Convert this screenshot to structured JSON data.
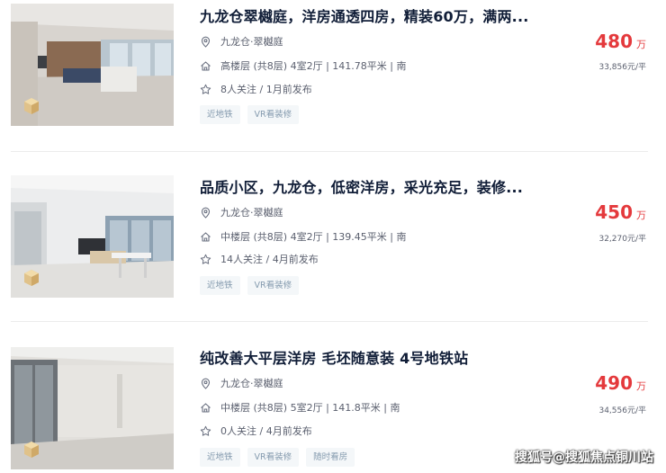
{
  "listings": [
    {
      "title": "九龙仓翠樾庭，洋房通透四房，精装60万，满两...",
      "community": "九龙仓·翠樾庭",
      "house_info": "高楼层 (共8层) 4室2厅 | 141.78平米 | 南",
      "follow_info": "8人关注 / 1月前发布",
      "price": "480",
      "price_unit": "万",
      "unit_price": "33,856元/平",
      "tags": [
        "近地铁",
        "VR看装修"
      ]
    },
    {
      "title": "品质小区，九龙仓，低密洋房，采光充足，装修...",
      "community": "九龙仓·翠樾庭",
      "house_info": "中楼层 (共8层) 4室2厅 | 139.45平米 | 南",
      "follow_info": "14人关注 / 4月前发布",
      "price": "450",
      "price_unit": "万",
      "unit_price": "32,270元/平",
      "tags": [
        "近地铁",
        "VR看装修"
      ]
    },
    {
      "title": "纯改善大平层洋房 毛坯随意装 4号地铁站",
      "community": "九龙仓·翠樾庭",
      "house_info": "中楼层 (共8层) 5室2厅 | 141.8平米 | 南",
      "follow_info": "0人关注 / 4月前发布",
      "price": "490",
      "price_unit": "万",
      "unit_price": "34,556元/平",
      "tags": [
        "近地铁",
        "VR看装修",
        "随时看房"
      ]
    }
  ],
  "icons": {
    "location": "location-pin-icon",
    "house": "house-icon",
    "star": "star-icon",
    "vr": "vr-cube-icon"
  },
  "colors": {
    "title": "#101d37",
    "price": "#e4393c",
    "tag_text": "#849aae",
    "tag_bg": "#f4f7f9"
  },
  "watermark": "搜狐号@搜狐焦点铜川站"
}
